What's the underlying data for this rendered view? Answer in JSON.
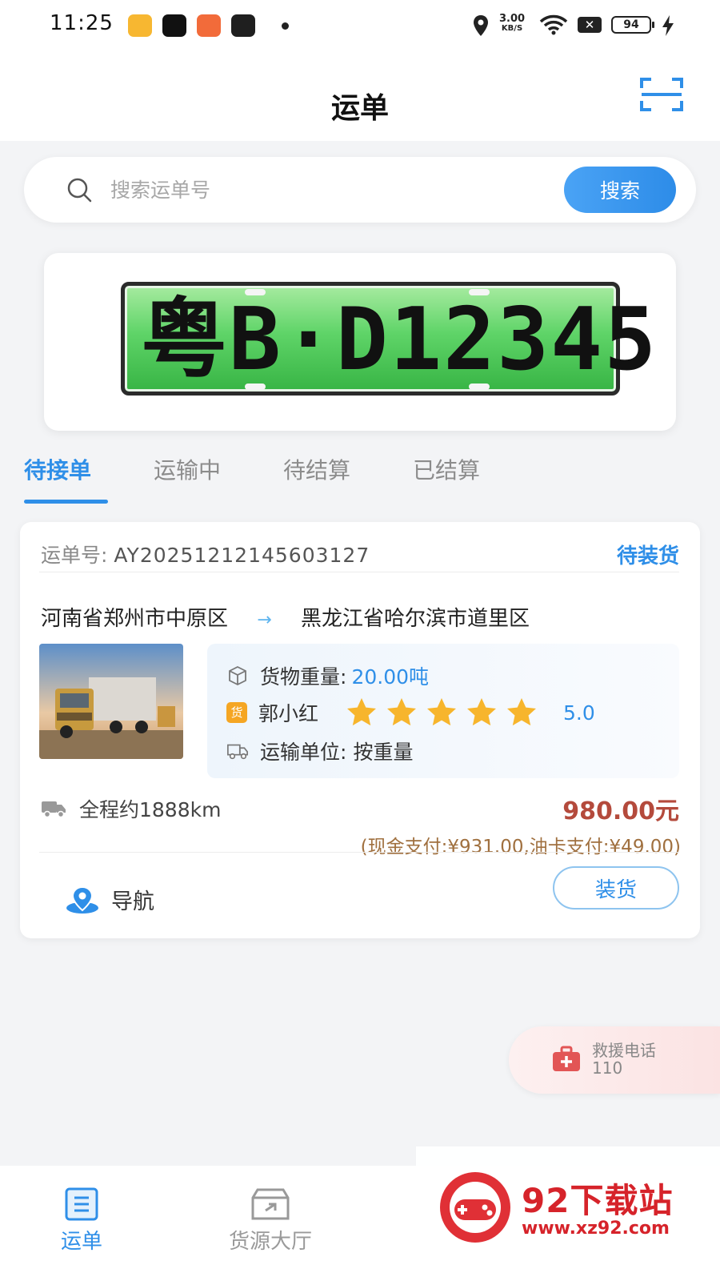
{
  "status_bar": {
    "time": "11:25",
    "speed_value": "3.00",
    "speed_unit": "KB/S",
    "battery": "94"
  },
  "header": {
    "title": "运单"
  },
  "search": {
    "placeholder": "搜索运单号",
    "button_label": "搜索"
  },
  "banner": {
    "plate_text": "粤B·D12345"
  },
  "tabs": [
    {
      "label": "待接单",
      "active": true
    },
    {
      "label": "运输中",
      "active": false
    },
    {
      "label": "待结算",
      "active": false
    },
    {
      "label": "已结算",
      "active": false
    }
  ],
  "order": {
    "number_label": "运单号:",
    "number": "AY20251212145603127",
    "status": "待装货",
    "origin": "河南省郑州市中原区",
    "destination": "黑龙江省哈尔滨市道里区",
    "weight_label": "货物重量:",
    "weight_value": "20.00吨",
    "shipper_badge": "货",
    "shipper_name": "郭小红",
    "rating_stars": 5,
    "rating": "5.0",
    "unit_label": "运输单位:",
    "unit_value": "按重量",
    "distance": "全程约1888km",
    "price": "980.00元",
    "payment_detail": "(现金支付:¥931.00,油卡支付:¥49.00)",
    "nav_label": "导航",
    "load_label": "装货"
  },
  "rescue": {
    "label": "救援电话",
    "number": "110"
  },
  "bottom_nav": [
    {
      "label": "运单",
      "icon": "waybill-icon",
      "active": true
    },
    {
      "label": "货源大厅",
      "icon": "cargo-hall-icon",
      "active": false
    }
  ],
  "watermark": {
    "title": "92下载站",
    "url": "www.xz92.com"
  },
  "colors": {
    "accent": "#2f8fe8",
    "price": "#b44a3c",
    "payment": "#a0703f",
    "star": "#f7b52c",
    "background": "#f3f4f6"
  }
}
